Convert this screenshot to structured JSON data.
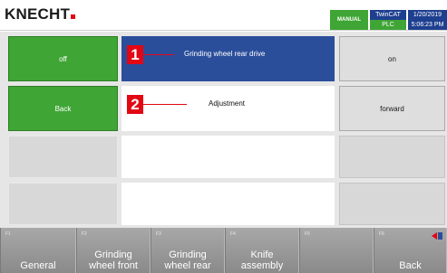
{
  "header": {
    "logo": "KNECHT",
    "mode": "MANUAL",
    "status_top": "TwinCAT",
    "status_bottom": "PLC",
    "date": "1/20/2019",
    "time": "5:06:23 PM"
  },
  "left_buttons": [
    "off",
    "Back"
  ],
  "right_buttons": [
    "on",
    "forward"
  ],
  "rows": [
    {
      "marker": "1",
      "label": "Grinding wheel rear drive",
      "selected": true
    },
    {
      "marker": "2",
      "label": "Adjustment",
      "selected": false
    }
  ],
  "function_keys": [
    {
      "num": "F1",
      "label": "General"
    },
    {
      "num": "F2",
      "label": "Grinding\nwheel front"
    },
    {
      "num": "F3",
      "label": "Grinding\nwheel rear"
    },
    {
      "num": "F4",
      "label": "Knife\nassembly"
    },
    {
      "num": "F5",
      "label": ""
    },
    {
      "num": "F6",
      "label": "Back"
    }
  ],
  "colors": {
    "accent_green": "#3fa535",
    "accent_blue": "#2b4e9b",
    "marker_red": "#e30613"
  }
}
